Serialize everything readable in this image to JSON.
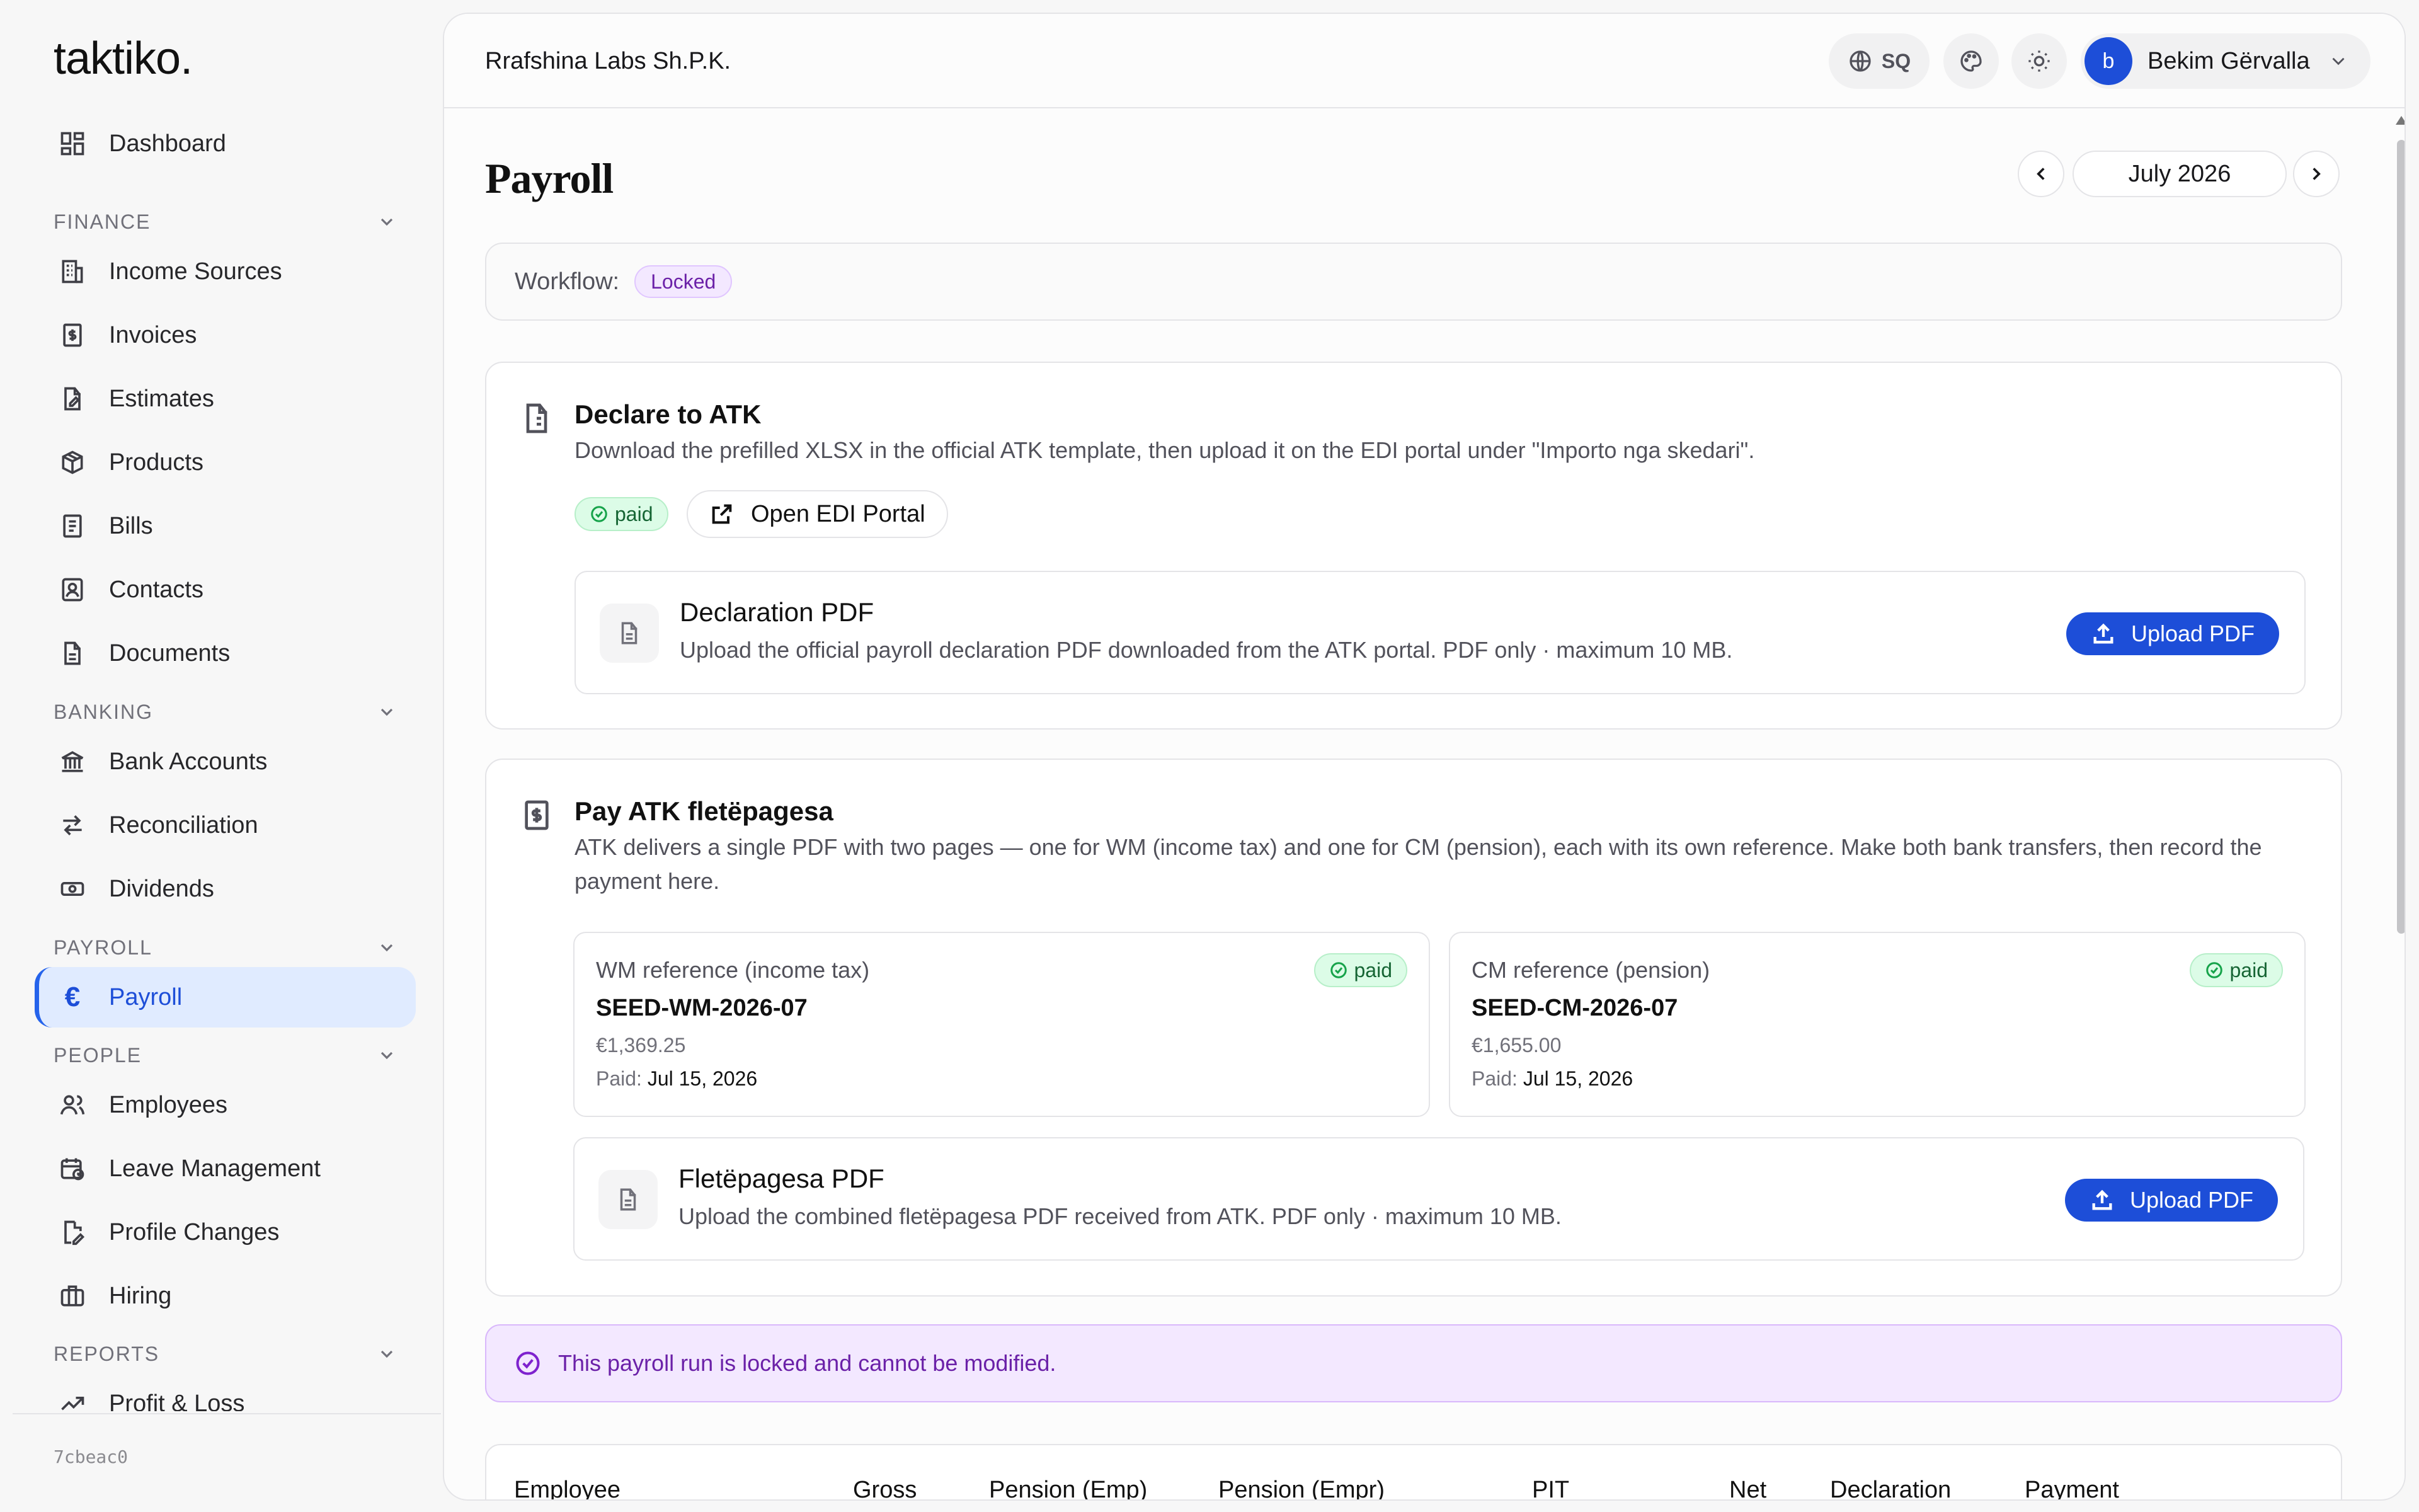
{
  "sidebar": {
    "logo": "taktiko.",
    "dashboard": "Dashboard",
    "sections": {
      "finance": "FINANCE",
      "banking": "BANKING",
      "payroll": "PAYROLL",
      "people": "PEOPLE",
      "reports": "REPORTS"
    },
    "items": {
      "income_sources": "Income Sources",
      "invoices": "Invoices",
      "estimates": "Estimates",
      "products": "Products",
      "bills": "Bills",
      "contacts": "Contacts",
      "documents": "Documents",
      "bank_accounts": "Bank Accounts",
      "reconciliation": "Reconciliation",
      "dividends": "Dividends",
      "payroll": "Payroll",
      "employees": "Employees",
      "leave_management": "Leave Management",
      "profile_changes": "Profile Changes",
      "hiring": "Hiring",
      "profit_loss": "Profit & Loss"
    },
    "payroll_icon": "€",
    "version": "7cbeac0"
  },
  "header": {
    "company": "Rrafshina Labs Sh.P.K.",
    "language": "SQ",
    "user_initial": "b",
    "user_name": "Bekim Gërvalla"
  },
  "page": {
    "title": "Payroll",
    "month": "July 2026"
  },
  "workflow": {
    "label": "Workflow:",
    "status": "Locked"
  },
  "declare": {
    "title": "Declare to ATK",
    "description": "Download the prefilled XLSX in the official ATK template, then upload it on the EDI portal under \"Importo nga skedari\".",
    "status": "paid",
    "portal_button": "Open EDI Portal",
    "pdf": {
      "title": "Declaration PDF",
      "description": "Upload the official payroll declaration PDF downloaded from the ATK portal. PDF only · maximum 10 MB.",
      "button": "Upload PDF"
    }
  },
  "pay": {
    "title": "Pay ATK fletëpagesa",
    "description": "ATK delivers a single PDF with two pages — one for WM (income tax) and one for CM (pension), each with its own reference. Make both bank transfers, then record the payment here.",
    "wm": {
      "label": "WM reference (income tax)",
      "status": "paid",
      "code": "SEED-WM-2026-07",
      "amount": "€1,369.25",
      "paid_label": "Paid:",
      "paid_date": "Jul 15, 2026"
    },
    "cm": {
      "label": "CM reference (pension)",
      "status": "paid",
      "code": "SEED-CM-2026-07",
      "amount": "€1,655.00",
      "paid_label": "Paid:",
      "paid_date": "Jul 15, 2026"
    },
    "pdf": {
      "title": "Fletëpagesa PDF",
      "description": "Upload the combined fletëpagesa PDF received from ATK. PDF only · maximum 10 MB.",
      "button": "Upload PDF"
    }
  },
  "locked_notice": "This payroll run is locked and cannot be modified.",
  "table": {
    "columns": [
      "Employee",
      "Gross",
      "Pension (Emp)",
      "Pension (Empr)",
      "PIT",
      "Net",
      "Declaration",
      "Payment"
    ]
  }
}
